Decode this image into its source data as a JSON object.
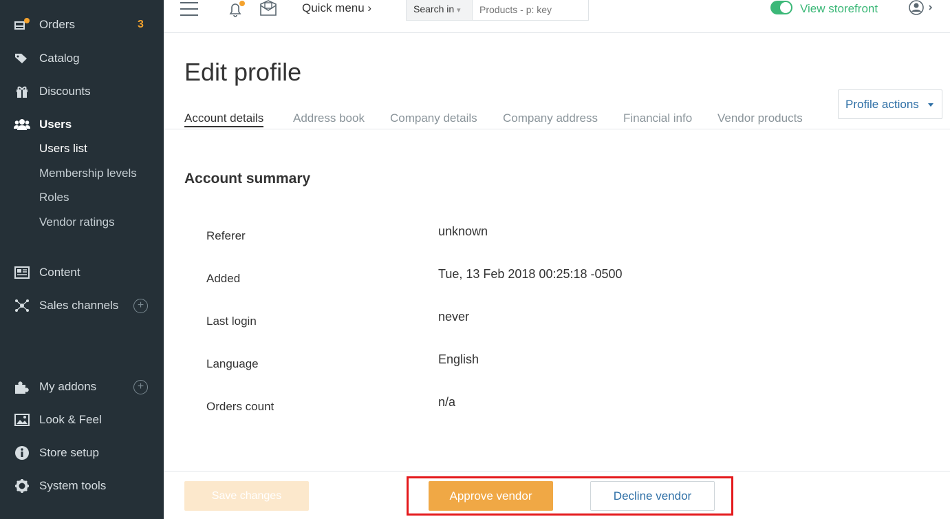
{
  "sidebar": {
    "orders": {
      "label": "Orders",
      "badge": "3"
    },
    "catalog": {
      "label": "Catalog"
    },
    "discounts": {
      "label": "Discounts"
    },
    "users": {
      "label": "Users"
    },
    "users_sub": [
      "Users list",
      "Membership levels",
      "Roles",
      "Vendor ratings"
    ],
    "content": {
      "label": "Content"
    },
    "sales_channels": {
      "label": "Sales channels"
    },
    "my_addons": {
      "label": "My addons"
    },
    "look_feel": {
      "label": "Look & Feel"
    },
    "store_setup": {
      "label": "Store setup"
    },
    "system_tools": {
      "label": "System tools"
    }
  },
  "topbar": {
    "quick_menu": "Quick menu ›",
    "search_in": "Search in",
    "search_placeholder": "Products - p: key",
    "view_storefront": "View storefront"
  },
  "page": {
    "title": "Edit profile",
    "profile_actions": "Profile actions",
    "tabs": [
      "Account details",
      "Address book",
      "Company details",
      "Company address",
      "Financial info",
      "Vendor products"
    ],
    "active_tab": "Account details"
  },
  "summary": {
    "title": "Account summary",
    "rows": [
      {
        "label": "Referer",
        "value": "unknown"
      },
      {
        "label": "Added",
        "value": "Tue, 13 Feb 2018 00:25:18 -0500"
      },
      {
        "label": "Last login",
        "value": "never"
      },
      {
        "label": "Language",
        "value": "English"
      },
      {
        "label": "Orders count",
        "value": "n/a"
      }
    ]
  },
  "footer": {
    "save": "Save changes",
    "approve": "Approve vendor",
    "decline": "Decline vendor"
  },
  "colors": {
    "sidebar_bg": "#253037",
    "accent_orange": "#f0a845",
    "link_blue": "#2e6fa6",
    "storefront_green": "#3cb878",
    "highlight_red": "#e4191c"
  }
}
